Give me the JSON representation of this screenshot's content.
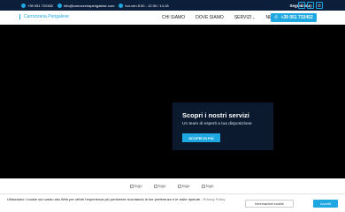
{
  "topbar": {
    "phone": "+39 051 722452",
    "email": "info@carrozzeriaperigalese.com",
    "hours": "lun-ven 8:30 - 12:30 / 14-18",
    "follow_label": "Seguici su",
    "socials": [
      {
        "icon": "facebook-icon",
        "glyph": "f"
      },
      {
        "icon": "instagram-icon",
        "glyph": "◎"
      },
      {
        "icon": "whatsapp-icon",
        "glyph": "✆"
      }
    ]
  },
  "header": {
    "logo_text": "Carrozzeria Perigalese",
    "nav": [
      "CHI SIAMO",
      "DOVE SIAMO",
      "SERVIZI",
      "NEWS"
    ],
    "nav_dropdown_icon": "chevron-down-icon",
    "call_button": "+39 051 722452"
  },
  "hero": {
    "card_title": "Scopri i nostri servizi",
    "card_subtitle": "Un team di esperti a tua disposizione",
    "card_button": "SCOPRI DI PIÙ"
  },
  "logos": [
    "logo",
    "logo",
    "logo",
    "logo"
  ],
  "cookie": {
    "text": "Utilizziamo i cookie sul nostro sito Web per offrirti l'esperienza più pertinente ricordando le tue preferenze e le visite ripetute -",
    "policy_link": "Privacy Policy",
    "info_button": "Informazioni cookie",
    "accept_button": "Accetti"
  },
  "colors": {
    "accent": "#1ea7e1",
    "topbar_bg": "#0b1e3a",
    "card_bg": "#0c1a30"
  }
}
